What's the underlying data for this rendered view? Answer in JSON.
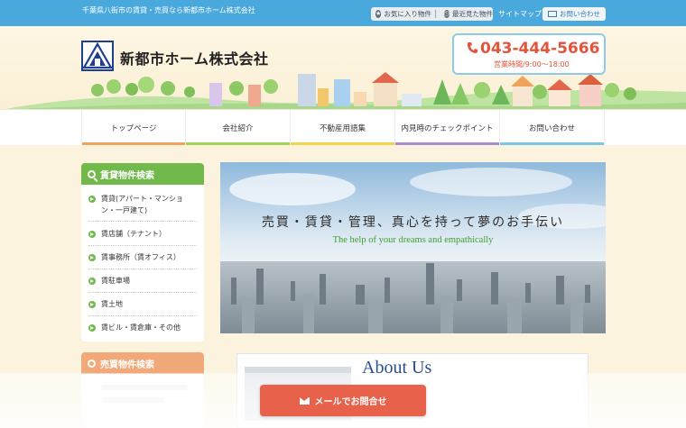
{
  "topbar": {
    "tagline": "千葉県八街市の賃貸・売買なら新都市ホーム株式会社",
    "favorites": "お気に入り物件",
    "recent": "最近見た物件",
    "sitemap": "サイトマップ",
    "contact": "お問い合わせ"
  },
  "header": {
    "company": "新都市ホーム株式会社",
    "phone": "043-444-5666",
    "hours": "営業時間/9:00～18:00"
  },
  "nav": {
    "items": [
      {
        "label": "トップページ",
        "color": "#f0a35a"
      },
      {
        "label": "会社紹介",
        "color": "#9fd35a"
      },
      {
        "label": "不動産用語集",
        "color": "#f3d34a"
      },
      {
        "label": "内見時のチェックポイント",
        "color": "#a98bd0"
      },
      {
        "label": "お問い合わせ",
        "color": "#7cc7e8"
      }
    ]
  },
  "sidebar": {
    "rental_title": "賃貸物件検索",
    "rental_items": [
      "賃貸(アパート・マンション・一戸建て)",
      "賃店舗（テナント）",
      "賃事務所（賃オフィス）",
      "賃駐車場",
      "賃土地",
      "賃ビル・賃倉庫・その他"
    ],
    "sale_title": "売買物件検索"
  },
  "hero": {
    "copy": "売買・賃貸・管理、真心を持って夢のお手伝い",
    "subcopy": "The help of your dreams and empathically"
  },
  "about": {
    "title": "About Us"
  },
  "cta": {
    "mail": "メールでお問合せ"
  },
  "colors": {
    "topbar": "#4aa9dc",
    "accent_green": "#71b94b",
    "accent_orange": "#f2a97a",
    "phone_red": "#e2543c",
    "cta": "#e8614a"
  }
}
